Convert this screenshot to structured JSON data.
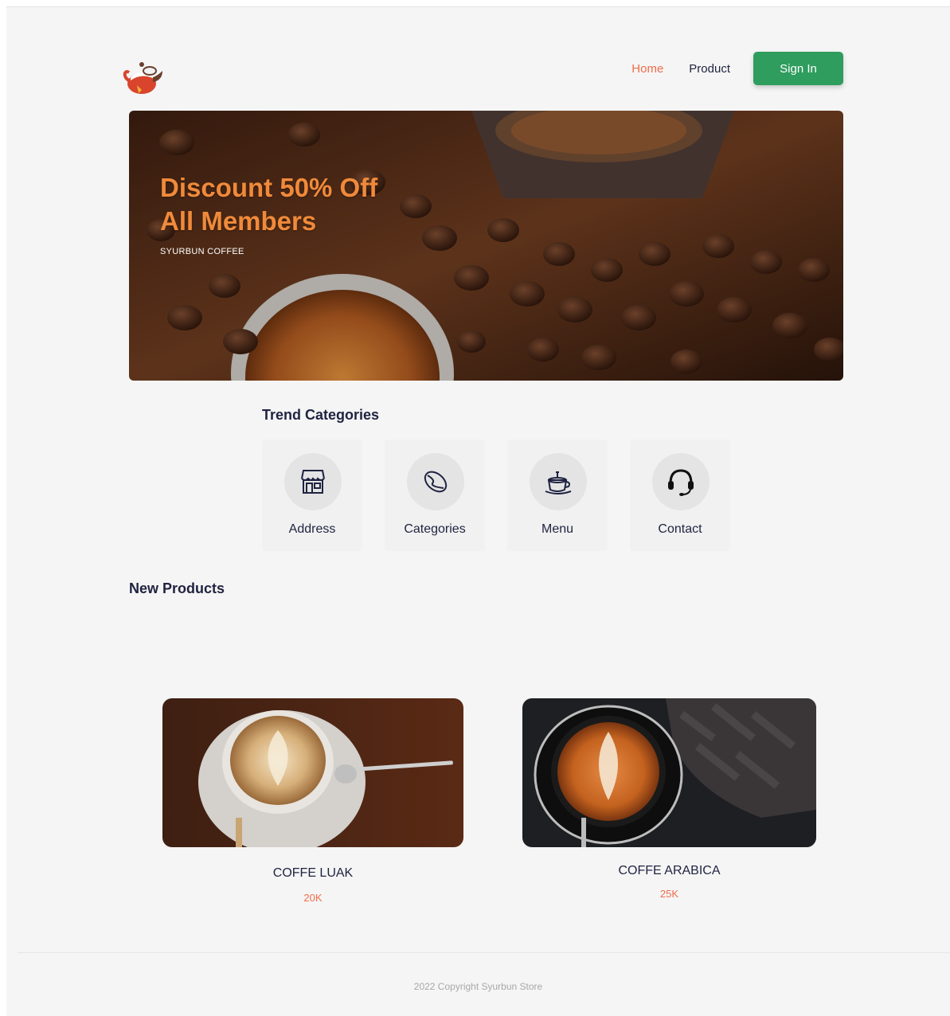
{
  "brand": {
    "logo_icon": "teapot-logo-icon"
  },
  "nav": {
    "home_label": "Home",
    "product_label": "Product",
    "signin_label": "Sign In",
    "accent": "#ef6c4a",
    "signin_color": "#2e9d5d"
  },
  "hero": {
    "title_line1": "Discount 50% Off",
    "title_line2": "All Members",
    "subtitle": "SYURBUN COFFEE",
    "title_color": "#f08a3a"
  },
  "trend": {
    "title": "Trend Categories",
    "items": [
      {
        "label": "Address",
        "icon": "store-icon"
      },
      {
        "label": "Categories",
        "icon": "coffee-bean-icon"
      },
      {
        "label": "Menu",
        "icon": "coffee-cup-icon"
      },
      {
        "label": "Contact",
        "icon": "headset-icon"
      }
    ]
  },
  "new_products": {
    "title": "New Products",
    "items": [
      {
        "name": "COFFE LUAK",
        "price": "20K"
      },
      {
        "name": "COFFE ARABICA",
        "price": "25K"
      }
    ]
  },
  "footer": {
    "copyright": "2022 Copyright Syurbun Store"
  }
}
